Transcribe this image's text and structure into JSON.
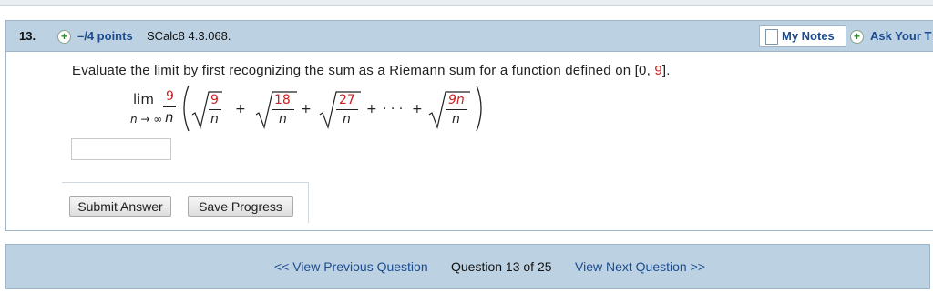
{
  "question": {
    "number": "13.",
    "points": "–/4 points",
    "id": "SCalc8 4.3.068.",
    "my_notes": "My Notes",
    "ask_teacher": "Ask Your T",
    "prompt_pre": "Evaluate the limit by first recognizing the sum as a Riemann sum for a function defined on [0, ",
    "prompt_num": "9",
    "prompt_post": "].",
    "math": {
      "lim": "lim",
      "lim_sub": "n → ∞",
      "coef_num": "9",
      "coef_den": "n",
      "terms": [
        {
          "num": "9",
          "den": "n"
        },
        {
          "num": "18",
          "den": "n"
        },
        {
          "num": "27",
          "den": "n"
        }
      ],
      "plus": "+",
      "ellipsis": "· · ·",
      "last_num": "9n",
      "last_den": "n"
    },
    "answer_value": "",
    "submit_label": "Submit Answer",
    "save_label": "Save Progress"
  },
  "nav": {
    "prev_label": "<< View Previous Question",
    "position": "Question 13 of 25",
    "next_label": "View Next Question >>"
  },
  "colors": {
    "header_bg": "#bcd1e2",
    "link": "#1d4c8e",
    "red_value": "#cc1f1f"
  }
}
